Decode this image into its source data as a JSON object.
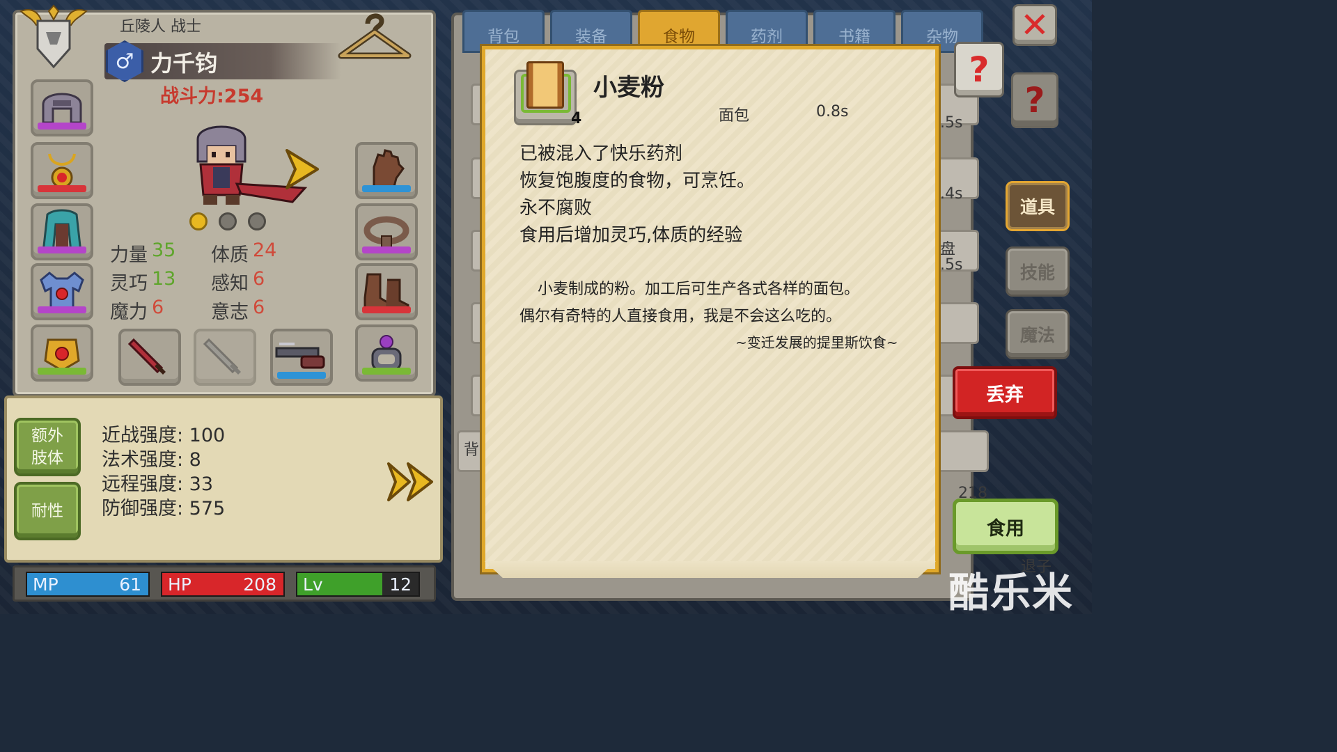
{
  "character": {
    "race_class": "丘陵人 战士",
    "gender_symbol": "♂",
    "name": "力千钧",
    "power": "战斗力:254",
    "attributes": [
      {
        "label": "力量",
        "value": "35"
      },
      {
        "label": "体质",
        "value": "24"
      },
      {
        "label": "灵巧",
        "value": "13"
      },
      {
        "label": "感知",
        "value": "6"
      },
      {
        "label": "魔力",
        "value": "6"
      },
      {
        "label": "意志",
        "value": "6"
      }
    ]
  },
  "stats": {
    "extra_limb_label": "额外\n肢体",
    "endurance_label": "耐性",
    "lines": [
      "近战强度: 100",
      "法术强度: 8",
      "远程强度: 33",
      "防御强度: 575"
    ]
  },
  "bars": {
    "mp": {
      "label": "MP",
      "value": "61",
      "fill": 1.0,
      "color": "#2e8fd0"
    },
    "hp": {
      "label": "HP",
      "value": "208",
      "fill": 1.0,
      "color": "#d8262a"
    },
    "lv": {
      "label": "Lv",
      "value": "12",
      "fill": 0.7,
      "color": "#3fa02a"
    }
  },
  "tabs": [
    "背包",
    "装备",
    "食物",
    "药剂",
    "书籍",
    "杂物"
  ],
  "active_tab": "食物",
  "categories": [
    "道具",
    "技能",
    "魔法"
  ],
  "buttons": {
    "close": "✕",
    "help": "?",
    "discard": "丢弃",
    "eat": "食用"
  },
  "background_fragments": {
    "t1": ".5s",
    "t2": ".4s",
    "t3": "盘",
    "t4": ".5s",
    "t5": "背",
    "t6": "218",
    "t7": "退子"
  },
  "item": {
    "count": "4",
    "name": "小麦粉",
    "type": "面包",
    "time": "0.8s",
    "effects": [
      "已被混入了快乐药剂",
      "恢复饱腹度的食物，可烹饪。",
      "永不腐败",
      "食用后增加灵巧,体质的经验"
    ],
    "lore": [
      "小麦制成的粉。加工后可生产各式各样的面包。",
      "偶尔有奇特的人直接食用，我是不会这么吃的。"
    ],
    "source": "~变迁发展的提里斯饮食~"
  },
  "watermark": "酷乐米",
  "colors": {
    "accent_gold": "#e0a82a",
    "power_red": "#c73a2e",
    "stat_green": "#5ea52b",
    "stat_red": "#d04a3a"
  },
  "icons": {
    "helmet": "helmet-icon",
    "amulet": "amulet-icon",
    "cloak": "cloak-icon",
    "armor": "armor-icon",
    "belt": "belt-icon",
    "ring": "ring-icon",
    "gloves": "gloves-icon",
    "girdle": "girdle-icon",
    "boots": "boots-icon",
    "ring2": "purple-ring-icon",
    "weapon": "sword-icon",
    "ranged": "crossbow-icon"
  }
}
